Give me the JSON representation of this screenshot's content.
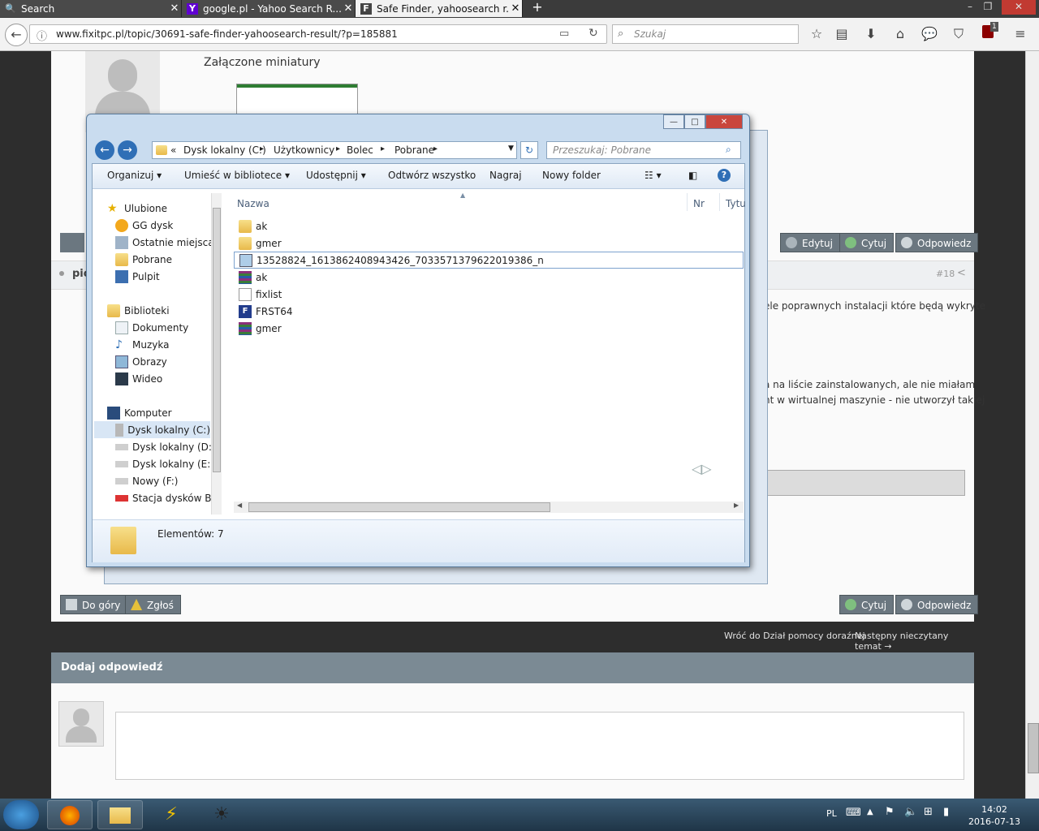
{
  "browser": {
    "tabs": [
      {
        "label": "Search",
        "icon": "search-favicon"
      },
      {
        "label": "google.pl - Yahoo Search R...",
        "icon": "yahoo-favicon"
      },
      {
        "label": "Safe Finder, yahoosearch r...",
        "icon": "fixitpc-favicon"
      }
    ],
    "new_tab": "+",
    "url": "www.fixitpc.pl/topic/30691-safe-finder-yahoosearch-result/?p=185881",
    "search_placeholder": "Szukaj",
    "notification_count": "1"
  },
  "page": {
    "attachments_label": "Załączone miniatury",
    "post_author_partial": "pic",
    "post_number": "#18",
    "post_text_1": "ele poprawnych instalacji które będą wykryte",
    "post_text_2": "a na liście zainstalowanych, ale nie miałam",
    "post_text_3": "nt w wirtualnej maszynie - nie utworzył takiej",
    "top_actions": [
      "Edytuj",
      "Cytuj",
      "Odpowiedz"
    ],
    "bottom_left_actions": [
      "Do góry",
      "Zgłoś"
    ],
    "bottom_right_actions": [
      "Cytuj",
      "Odpowiedz"
    ],
    "nav_back": "Wróć do Dział pomocy doraźnej",
    "nav_next": "Następny nieczytany temat →",
    "reply_header": "Dodaj odpowiedź"
  },
  "explorer": {
    "breadcrumb": [
      "«",
      "Dysk lokalny (C:)",
      "Użytkownicy",
      "Bolec",
      "Pobrane"
    ],
    "search_placeholder": "Przeszukaj: Pobrane",
    "commands": [
      "Organizuj",
      "Umieść w bibliotece",
      "Udostępnij",
      "Odtwórz wszystko",
      "Nagraj",
      "Nowy folder"
    ],
    "columns": [
      "Nazwa",
      "Nr",
      "Tytu"
    ],
    "nav": {
      "favorites_header": "Ulubione",
      "favorites": [
        "GG dysk",
        "Ostatnie miejsca",
        "Pobrane",
        "Pulpit"
      ],
      "libraries_header": "Biblioteki",
      "libraries": [
        "Dokumenty",
        "Muzyka",
        "Obrazy",
        "Wideo"
      ],
      "computer_header": "Komputer",
      "computer": [
        "Dysk lokalny (C:)",
        "Dysk lokalny (D:)",
        "Dysk lokalny (E:)",
        "Nowy (F:)",
        "Stacja dysków BD"
      ]
    },
    "files": [
      {
        "name": "ak",
        "type": "folder"
      },
      {
        "name": "gmer",
        "type": "folder"
      },
      {
        "name": "13528824_1613862408943426_7033571379622019386_n",
        "type": "image"
      },
      {
        "name": "ak",
        "type": "archive"
      },
      {
        "name": "fixlist",
        "type": "text"
      },
      {
        "name": "FRST64",
        "type": "exe"
      },
      {
        "name": "gmer",
        "type": "archive"
      }
    ],
    "status": "Elementów: 7"
  },
  "taskbar": {
    "language": "PL",
    "time": "14:02",
    "date": "2016-07-13"
  }
}
